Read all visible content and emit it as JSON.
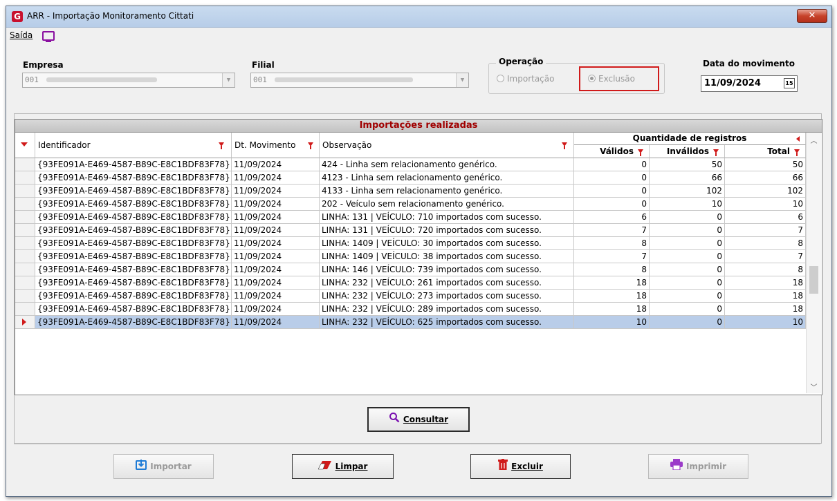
{
  "window": {
    "title": "ARR - Importação Monitoramento Cittati",
    "close_glyph": "✕"
  },
  "menu": {
    "saida": "Saída"
  },
  "form": {
    "empresa_label": "Empresa",
    "empresa_value": "001",
    "filial_label": "Filial",
    "filial_value": "001",
    "operacao_label": "Operação",
    "importacao_label": "Importação",
    "exclusao_label": "Exclusão",
    "selected_operation": "Exclusão",
    "data_label": "Data do movimento",
    "data_value": "11/09/2024"
  },
  "grid": {
    "title": "Importações realizadas",
    "headers": {
      "identificador": "Identificador",
      "dt_movimento": "Dt. Movimento",
      "observacao": "Observação",
      "quantidade": "Quantidade de registros",
      "validos": "Válidos",
      "invalidos": "Inválidos",
      "total": "Total"
    },
    "rows": [
      {
        "id": "{93FE091A-E469-4587-B89C-E8C1BDF83F78}",
        "dt": "11/09/2024",
        "obs": "424 - Linha sem relacionamento genérico.",
        "validos": "0",
        "invalidos": "50",
        "total": "50"
      },
      {
        "id": "{93FE091A-E469-4587-B89C-E8C1BDF83F78}",
        "dt": "11/09/2024",
        "obs": "4123 - Linha sem relacionamento genérico.",
        "validos": "0",
        "invalidos": "66",
        "total": "66"
      },
      {
        "id": "{93FE091A-E469-4587-B89C-E8C1BDF83F78}",
        "dt": "11/09/2024",
        "obs": "4133 - Linha sem relacionamento genérico.",
        "validos": "0",
        "invalidos": "102",
        "total": "102"
      },
      {
        "id": "{93FE091A-E469-4587-B89C-E8C1BDF83F78}",
        "dt": "11/09/2024",
        "obs": " 202 - Veículo sem relacionamento genérico.",
        "validos": "0",
        "invalidos": "10",
        "total": "10"
      },
      {
        "id": "{93FE091A-E469-4587-B89C-E8C1BDF83F78}",
        "dt": "11/09/2024",
        "obs": "LINHA: 131 | VEÍCULO: 710 importados com sucesso.",
        "validos": "6",
        "invalidos": "0",
        "total": "6"
      },
      {
        "id": "{93FE091A-E469-4587-B89C-E8C1BDF83F78}",
        "dt": "11/09/2024",
        "obs": "LINHA: 131 | VEÍCULO: 720 importados com sucesso.",
        "validos": "7",
        "invalidos": "0",
        "total": "7"
      },
      {
        "id": "{93FE091A-E469-4587-B89C-E8C1BDF83F78}",
        "dt": "11/09/2024",
        "obs": "LINHA: 1409 | VEÍCULO: 30 importados com sucesso.",
        "validos": "8",
        "invalidos": "0",
        "total": "8"
      },
      {
        "id": "{93FE091A-E469-4587-B89C-E8C1BDF83F78}",
        "dt": "11/09/2024",
        "obs": "LINHA: 1409 | VEÍCULO: 38 importados com sucesso.",
        "validos": "7",
        "invalidos": "0",
        "total": "7"
      },
      {
        "id": "{93FE091A-E469-4587-B89C-E8C1BDF83F78}",
        "dt": "11/09/2024",
        "obs": "LINHA: 146 | VEÍCULO: 739 importados com sucesso.",
        "validos": "8",
        "invalidos": "0",
        "total": "8"
      },
      {
        "id": "{93FE091A-E469-4587-B89C-E8C1BDF83F78}",
        "dt": "11/09/2024",
        "obs": "LINHA: 232 | VEÍCULO: 261 importados com sucesso.",
        "validos": "18",
        "invalidos": "0",
        "total": "18"
      },
      {
        "id": "{93FE091A-E469-4587-B89C-E8C1BDF83F78}",
        "dt": "11/09/2024",
        "obs": "LINHA: 232 | VEÍCULO: 273 importados com sucesso.",
        "validos": "18",
        "invalidos": "0",
        "total": "18"
      },
      {
        "id": "{93FE091A-E469-4587-B89C-E8C1BDF83F78}",
        "dt": "11/09/2024",
        "obs": "LINHA: 232 | VEÍCULO: 289 importados com sucesso.",
        "validos": "18",
        "invalidos": "0",
        "total": "18"
      },
      {
        "id": "{93FE091A-E469-4587-B89C-E8C1BDF83F78}",
        "dt": "11/09/2024",
        "obs": "LINHA: 232 | VEÍCULO: 625 importados com sucesso.",
        "validos": "10",
        "invalidos": "0",
        "total": "10",
        "selected": true
      }
    ]
  },
  "buttons": {
    "consultar": "Consultar",
    "importar": "Importar",
    "limpar": "Limpar",
    "excluir": "Excluir",
    "imprimir": "Imprimir"
  },
  "colors": {
    "accent_red": "#d01a1a",
    "grid_title": "#a00000",
    "selection": "#b9cde9",
    "brand_purple": "#8a0fa0",
    "brand_blue": "#1e7bd6"
  }
}
